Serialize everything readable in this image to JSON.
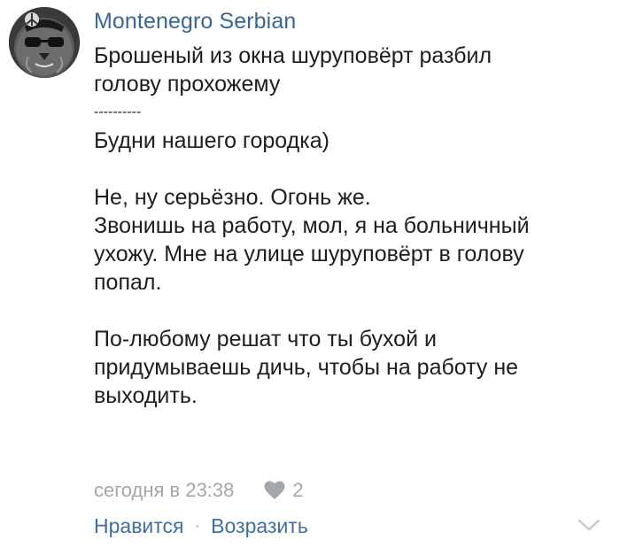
{
  "comment": {
    "author": "Montenegro Serbian",
    "avatar_icon": "lion-with-sunglasses-avatar",
    "lines": [
      "Брошеный из окна шуруповёрт разбил",
      "голову прохожему"
    ],
    "separator": "----------",
    "paragraph1": [
      "Будни нашего городка)"
    ],
    "paragraph2": [
      "Не, ну серьёзно. Огонь же.",
      "Звонишь на работу, мол, я на больничный",
      "ухожу. Мне на улице шуруповёрт в голову",
      "попал."
    ],
    "paragraph3": [
      "По-любому решат что ты бухой и",
      "придумываешь дичь, чтобы на работу не",
      "выходить."
    ],
    "timestamp": "сегодня в 23:38",
    "likes_count": "2",
    "like_label": "Нравится",
    "reply_label": "Возразить",
    "separator_dot": "·"
  },
  "colors": {
    "author": "#3a6597",
    "text": "#1e1e1e",
    "meta": "#a3a7ad",
    "link": "#3f6e9f"
  },
  "icons": {
    "like": "heart-icon",
    "expand": "chevron-down-icon"
  }
}
